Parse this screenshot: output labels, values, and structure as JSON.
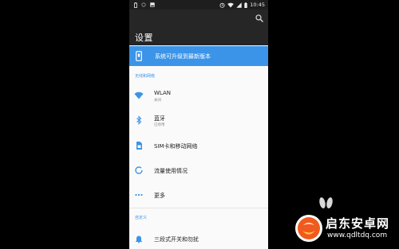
{
  "statusbar": {
    "time": "10:45"
  },
  "header": {
    "title": "设置"
  },
  "banner": {
    "text": "系统可升级到最新版本"
  },
  "sections": {
    "wireless": "无线和网络",
    "custom": "自定义"
  },
  "items": [
    {
      "title": "WLAN",
      "subtitle": "关闭",
      "icon": "wifi-icon"
    },
    {
      "title": "蓝牙",
      "subtitle": "已停用",
      "icon": "bluetooth-icon"
    },
    {
      "title": "SIM卡和移动网络",
      "icon": "sim-card-icon"
    },
    {
      "title": "流量使用情况",
      "icon": "data-usage-icon"
    },
    {
      "title": "更多",
      "icon": "more-icon"
    },
    {
      "title": "三段式开关和勿扰",
      "icon": "bell-icon"
    }
  ],
  "watermark": {
    "brand": "启东安卓网",
    "url": "www.qdltdq.com"
  },
  "colors": {
    "accent": "#3B94E8",
    "appbar": "#262626",
    "background": "#FAFAFA"
  }
}
